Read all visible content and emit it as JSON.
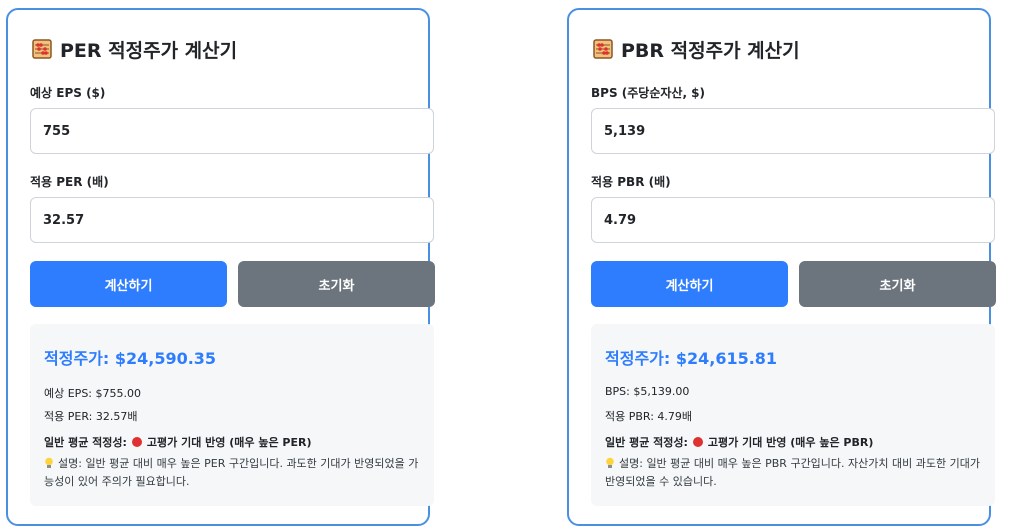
{
  "per_calc": {
    "title": "PER 적정주가 계산기",
    "field1": {
      "label": "예상 EPS ($)",
      "value": "755"
    },
    "field2": {
      "label": "적용 PER (배)",
      "value": "32.57"
    },
    "calc_button": "계산하기",
    "reset_button": "초기화",
    "result": {
      "fair_price": "적정주가: $24,590.35",
      "line1": "예상 EPS: $755.00",
      "line2": "적용 PER: 32.57배",
      "status_prefix": "일반 평균 적정성:",
      "status_text": "고평가 기대 반영 (매우 높은 PER)",
      "status_color": "#e03131",
      "description": "설명: 일반 평균 대비 매우 높은 PER 구간입니다. 과도한 기대가 반영되었을 가능성이 있어 주의가 필요합니다."
    }
  },
  "pbr_calc": {
    "title": "PBR 적정주가 계산기",
    "field1": {
      "label": "BPS (주당순자산, $)",
      "value": "5,139"
    },
    "field2": {
      "label": "적용 PBR (배)",
      "value": "4.79"
    },
    "calc_button": "계산하기",
    "reset_button": "초기화",
    "result": {
      "fair_price": "적정주가: $24,615.81",
      "line1": "BPS: $5,139.00",
      "line2": "적용 PBR: 4.79배",
      "status_prefix": "일반 평균 적정성:",
      "status_text": "고평가 기대 반영 (매우 높은 PBR)",
      "status_color": "#e03131",
      "description": "설명: 일반 평균 대비 매우 높은 PBR 구간입니다. 자산가치 대비 과도한 기대가 반영되었을 수 있습니다."
    }
  },
  "icons": {
    "title_icon": "abacus-icon",
    "status_icon": "red-circle-icon",
    "desc_icon": "lightbulb-icon"
  },
  "colors": {
    "accent": "#2e7dff",
    "border": "#4a90e2",
    "reset": "#6c757d",
    "result_bg": "#f5f7f8"
  }
}
